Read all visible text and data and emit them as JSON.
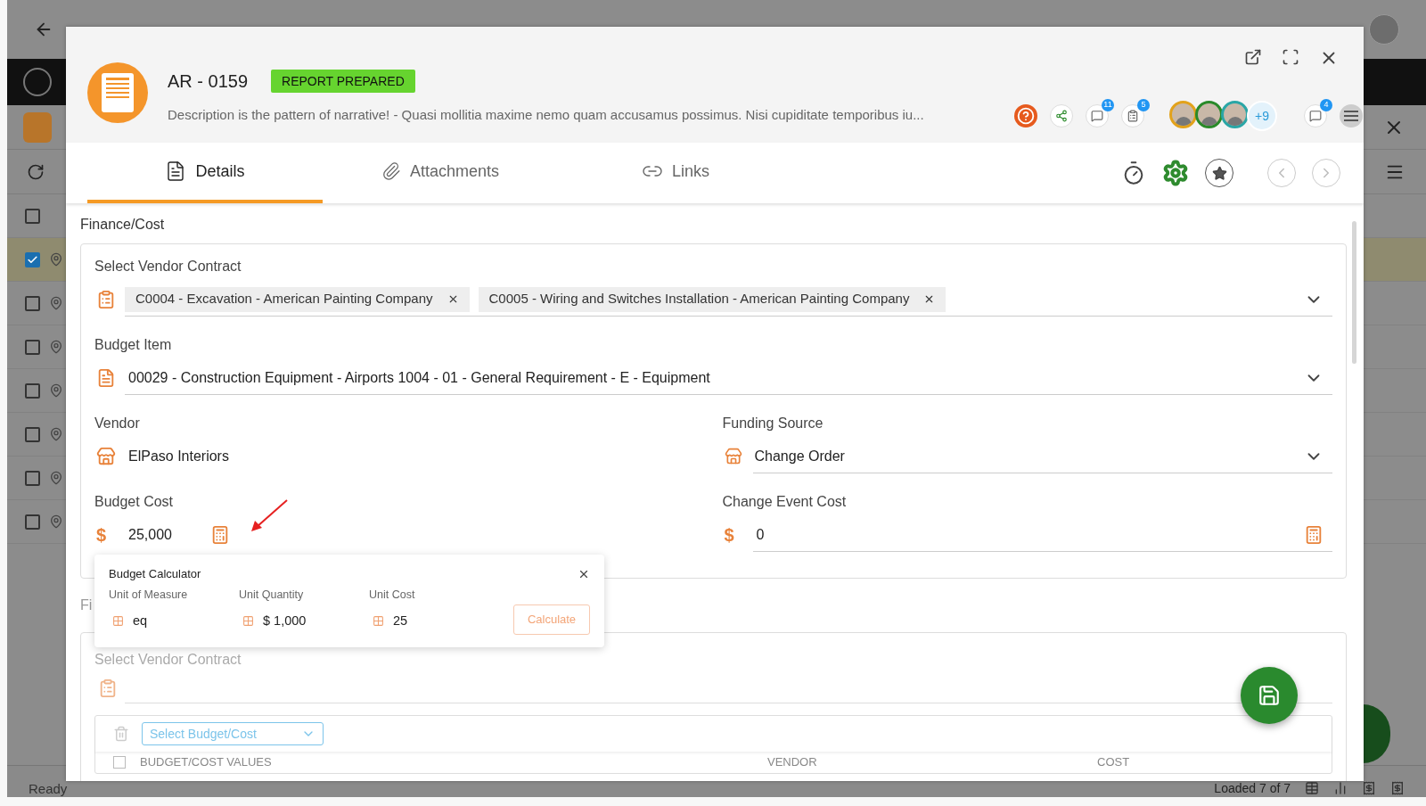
{
  "background": {
    "rows": [
      {
        "checked": false,
        "pin": false,
        "selected": false
      },
      {
        "checked": true,
        "pin": true,
        "selected": true
      },
      {
        "checked": false,
        "pin": true,
        "selected": false
      },
      {
        "checked": false,
        "pin": true,
        "selected": false
      },
      {
        "checked": false,
        "pin": true,
        "selected": false
      },
      {
        "checked": false,
        "pin": true,
        "selected": false
      },
      {
        "checked": false,
        "pin": true,
        "selected": false
      },
      {
        "checked": false,
        "pin": true,
        "selected": false
      }
    ],
    "status_left": "Ready",
    "status_right": "Loaded 7 of 7"
  },
  "modal": {
    "title": "AR - 0159",
    "status": "REPORT PREPARED",
    "description": "Description is the pattern of narrative!  - Quasi mollitia maxime nemo quam accusamus possimus. Nisi cupiditate temporibus iu...",
    "badges": [
      {
        "kind": "help"
      },
      {
        "kind": "share"
      },
      {
        "kind": "comments",
        "count": "11"
      },
      {
        "kind": "tasks",
        "count": "5"
      }
    ],
    "avatars": [
      {
        "color": "#e2a21b"
      },
      {
        "color": "#2a8a2a"
      },
      {
        "color": "#2aa6a6"
      }
    ],
    "more_people": "+9",
    "chat_count": "4",
    "tabs": [
      {
        "label": "Details",
        "kind": "details",
        "selected": true
      },
      {
        "label": "Attachments",
        "kind": "attachments",
        "selected": false
      },
      {
        "label": "Links",
        "kind": "links",
        "selected": false
      }
    ],
    "section_title": "Finance/Cost",
    "vendor_contract": {
      "label": "Select Vendor Contract",
      "chips": [
        "C0004 - Excavation - American Painting Company",
        "C0005 - Wiring and Switches Installation - American Painting Company"
      ]
    },
    "budget_item": {
      "label": "Budget Item",
      "value": "00029 - Construction Equipment - Airports 1004 - 01 - General Requirement - E - Equipment"
    },
    "vendor": {
      "label": "Vendor",
      "value": "ElPaso Interiors"
    },
    "funding_source": {
      "label": "Funding Source",
      "value": "Change Order"
    },
    "budget_cost": {
      "label": "Budget Cost",
      "currency": "$",
      "value": "25,000"
    },
    "change_event_cost": {
      "label": "Change Event Cost",
      "currency": "$",
      "value": "0"
    },
    "calculator": {
      "title": "Budget Calculator",
      "columns": [
        {
          "label": "Unit of Measure",
          "value": "eq"
        },
        {
          "label": "Unit Quantity",
          "value": "$ 1,000"
        },
        {
          "label": "Unit Cost",
          "value": "25"
        }
      ],
      "button": "Calculate"
    },
    "second_section": {
      "title": "Fi",
      "select_all": {
        "checked": false
      },
      "field_label": "Select Vendor Contract",
      "dropdown_placeholder": "Select Budget/Cost",
      "columns": [
        "BUDGET/COST VALUES",
        "VENDOR",
        "COST"
      ]
    }
  }
}
